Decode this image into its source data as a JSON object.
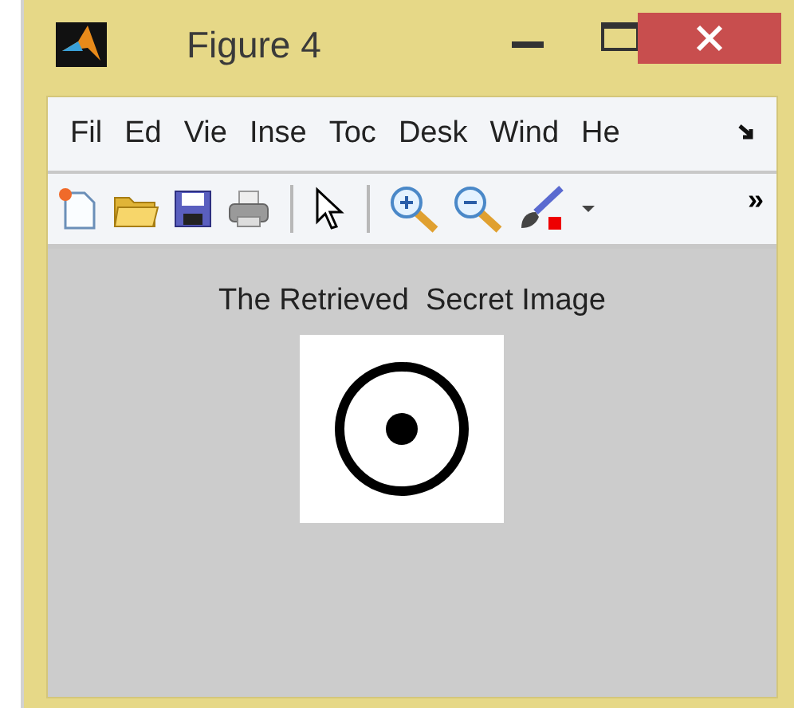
{
  "window": {
    "title": "Figure 4"
  },
  "menu": [
    {
      "label": "Fil"
    },
    {
      "label": "Ed"
    },
    {
      "label": "Vie"
    },
    {
      "label": "Inse"
    },
    {
      "label": "Toc"
    },
    {
      "label": "Desk"
    },
    {
      "label": "Wind"
    },
    {
      "label": "He"
    }
  ],
  "toolbar": [
    {
      "kind": "new"
    },
    {
      "kind": "open"
    },
    {
      "kind": "save"
    },
    {
      "kind": "print"
    },
    {
      "kind": "separator"
    },
    {
      "kind": "pointer"
    },
    {
      "kind": "separator"
    },
    {
      "kind": "zoom-in"
    },
    {
      "kind": "zoom-out"
    },
    {
      "kind": "brush"
    },
    {
      "kind": "dropdown"
    },
    {
      "kind": "overflow",
      "label": "»"
    }
  ],
  "axes": {
    "title": "The Retrieved  Secret Image"
  }
}
